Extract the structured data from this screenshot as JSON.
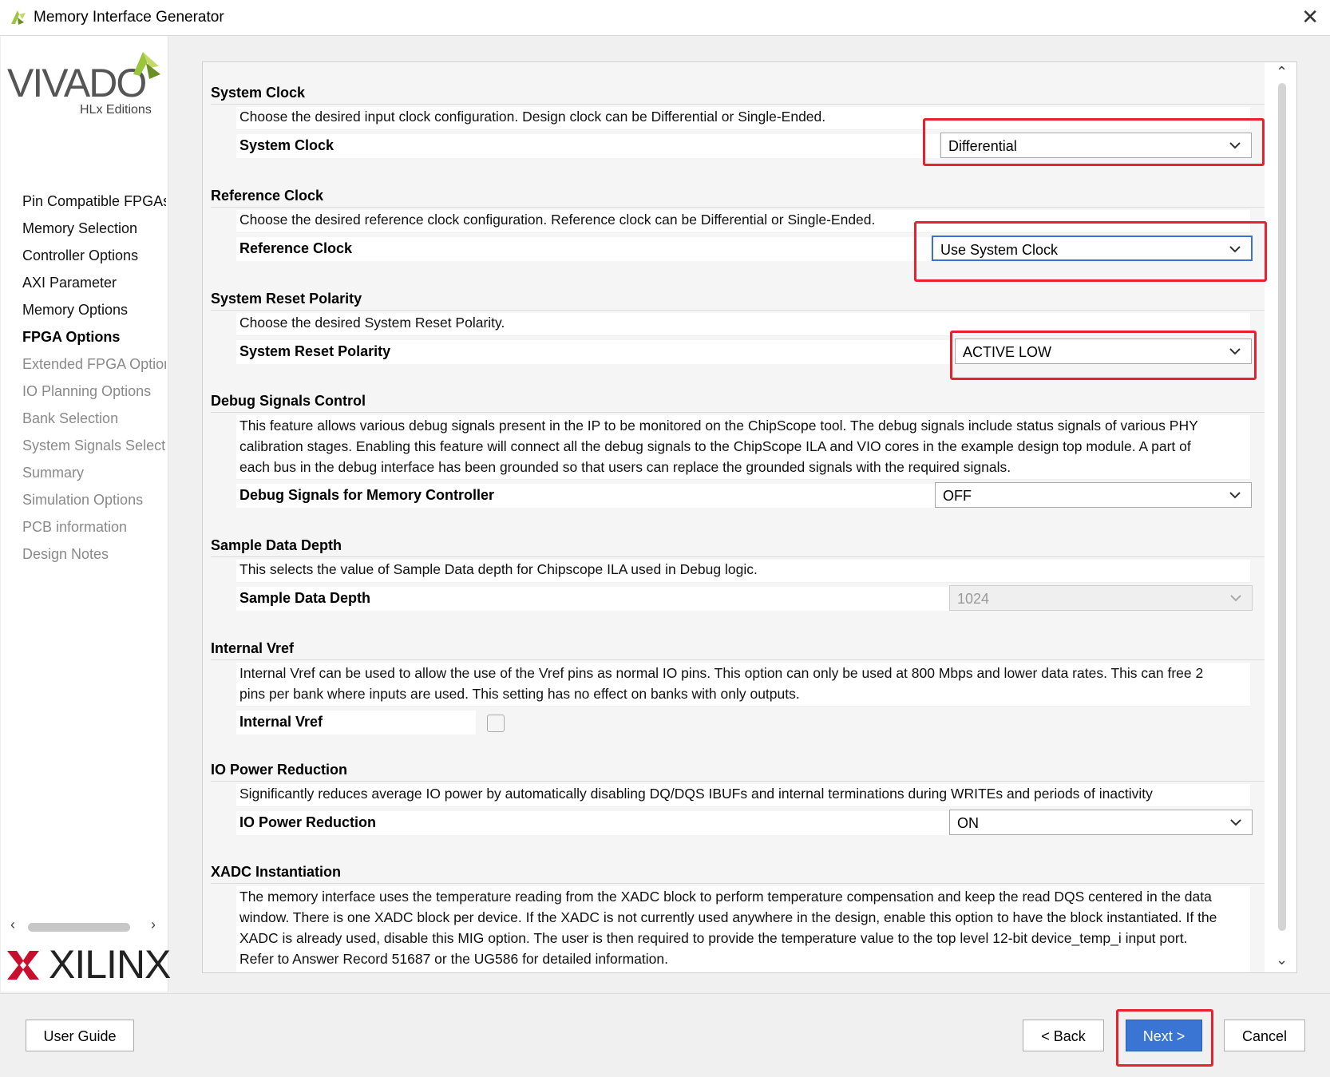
{
  "window": {
    "title": "Memory Interface Generator",
    "close": "✕"
  },
  "branding": {
    "vivado": "VIVADO",
    "editions": "HLx Editions",
    "xilinx": "XILINX"
  },
  "sidebar": {
    "items": [
      {
        "label": "Pin Compatible FPGAs",
        "state": "done"
      },
      {
        "label": "Memory Selection",
        "state": "done"
      },
      {
        "label": "Controller Options",
        "state": "done"
      },
      {
        "label": "AXI Parameter",
        "state": "done"
      },
      {
        "label": "Memory Options",
        "state": "done"
      },
      {
        "label": "FPGA Options",
        "state": "active"
      },
      {
        "label": "Extended FPGA Options",
        "state": "pending"
      },
      {
        "label": "IO Planning Options",
        "state": "pending"
      },
      {
        "label": "Bank Selection",
        "state": "pending"
      },
      {
        "label": "System Signals Selection",
        "state": "pending"
      },
      {
        "label": "Summary",
        "state": "pending"
      },
      {
        "label": "Simulation Options",
        "state": "pending"
      },
      {
        "label": "PCB information",
        "state": "pending"
      },
      {
        "label": "Design Notes",
        "state": "pending"
      }
    ]
  },
  "sections": {
    "system_clock": {
      "title": "System Clock",
      "desc": "Choose the desired input clock configuration. Design clock can be Differential or Single-Ended.",
      "label": "System Clock",
      "value": "Differential"
    },
    "reference_clock": {
      "title": "Reference Clock",
      "desc": "Choose the desired reference clock configuration. Reference clock can be Differential or Single-Ended.",
      "label": "Reference Clock",
      "value": "Use System Clock"
    },
    "reset_polarity": {
      "title": "System Reset Polarity",
      "desc": "Choose the desired System Reset Polarity.",
      "label": "System Reset Polarity",
      "value": "ACTIVE LOW"
    },
    "debug": {
      "title": "Debug Signals Control",
      "desc_lines": [
        "This feature allows various debug signals present in the IP to be monitored on the ChipScope tool. The debug signals include status signals of various PHY",
        "calibration stages. Enabling this feature will connect all the debug signals to the ChipScope ILA and VIO cores in the example design top module. A part of",
        "each bus in the debug interface has been grounded so that users can replace the grounded signals with the required signals."
      ],
      "label": "Debug Signals for Memory Controller",
      "value": "OFF"
    },
    "sample_depth": {
      "title": "Sample Data Depth",
      "desc": "This selects the value of Sample Data depth for Chipscope ILA used in Debug logic.",
      "label": "Sample Data Depth",
      "value": "1024"
    },
    "vref": {
      "title": "Internal Vref",
      "desc_lines": [
        "Internal Vref can be used to allow the use of the Vref pins as normal IO pins. This option can only be used at 800 Mbps and lower data rates. This can free 2",
        "pins per bank where inputs are used. This setting has no effect on banks with only outputs."
      ],
      "label": "Internal Vref",
      "checked": false
    },
    "io_power": {
      "title": "IO Power Reduction",
      "desc": "Significantly reduces average IO power by automatically disabling DQ/DQS IBUFs and internal terminations during WRITEs and periods of inactivity",
      "label": "IO Power Reduction",
      "value": "ON"
    },
    "xadc": {
      "title": "XADC Instantiation",
      "desc_lines": [
        "The memory interface uses the temperature reading from the XADC block to perform temperature compensation and keep the read DQS centered in the data",
        "window. There is one XADC block per device. If the XADC is not currently used anywhere in the design, enable this option to have the block instantiated. If the",
        "XADC is already used, disable this MIG option. The user is then required to provide the temperature value to the top level 12-bit device_temp_i input port.",
        "Refer to Answer Record 51687 or the UG586 for detailed information."
      ]
    }
  },
  "buttons": {
    "user_guide": "User Guide",
    "back": "< Back",
    "next": "Next >",
    "cancel": "Cancel"
  },
  "colors": {
    "highlight": "#e8212f",
    "primary": "#3a75d4",
    "vivado_green": "#9bc53d",
    "xilinx_red": "#c8102e"
  }
}
